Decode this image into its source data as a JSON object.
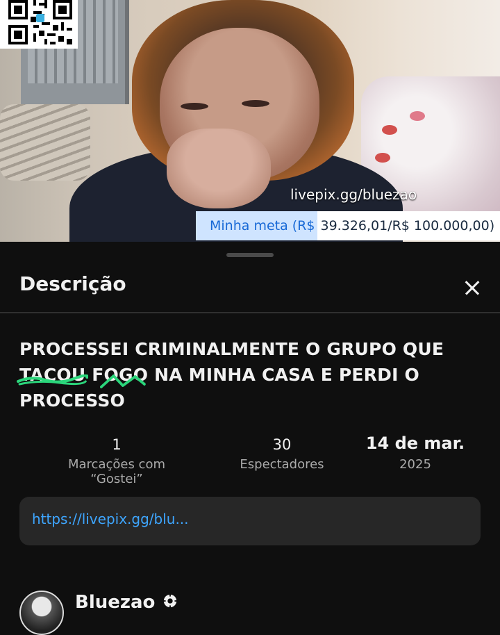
{
  "video": {
    "watermark": "livepix.gg/bluezao",
    "goal_label": "Minha meta (R$",
    "goal_values": "39.326,01/R$ 100.000,00)"
  },
  "sheet": {
    "header_title": "Descrição",
    "title_line1": "PROCESSEI CRIMINALMENTE O GRUPO QUE",
    "title_word_a": "TACOU",
    "title_space": " ",
    "title_word_b": "FOGO",
    "title_rest": " NA MINHA CASA E PERDI O PROCESSO",
    "stats": {
      "likes_value": "1",
      "likes_label": "Marcações com “Gostei”",
      "views_value": "30",
      "views_label": "Espectadores",
      "date_value": "14 de mar.",
      "date_year": "2025"
    },
    "link_text": "https://livepix.gg/blu...",
    "channel_name": "Bluezao"
  },
  "colors": {
    "link": "#3ea6ff",
    "scribble": "#2bd67b",
    "goal_text": "#1869d6"
  },
  "icons": [
    "qr-code-icon",
    "close-icon",
    "verified-icon"
  ]
}
